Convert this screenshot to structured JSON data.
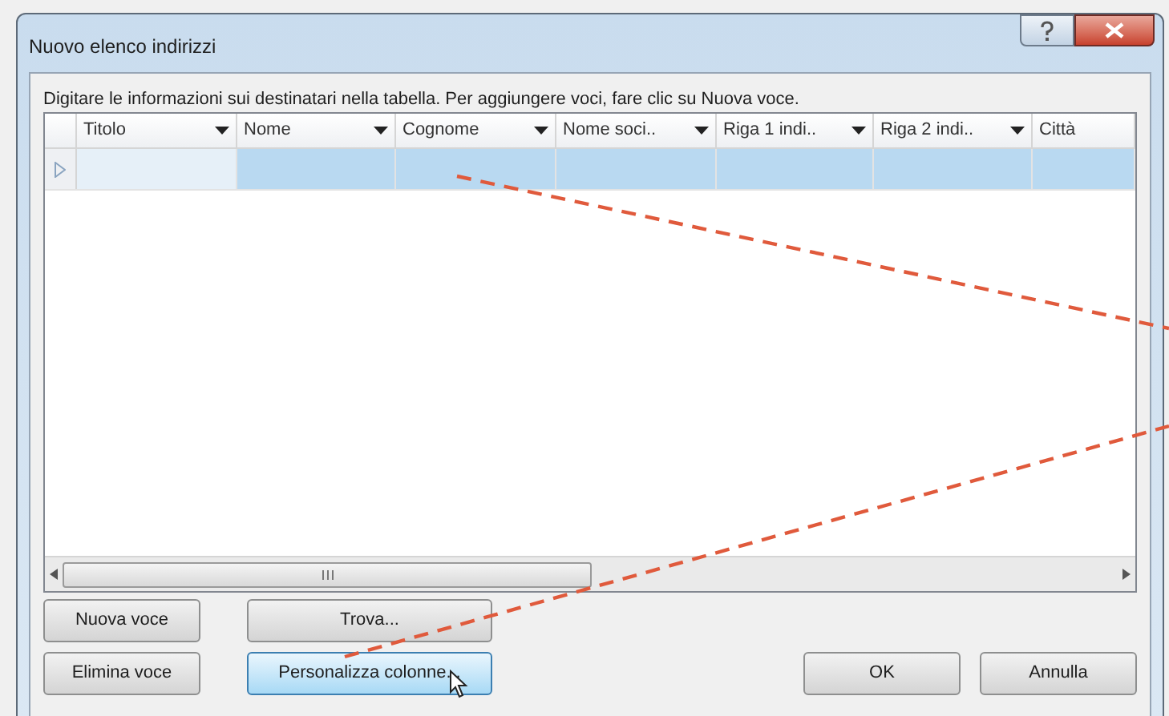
{
  "window": {
    "title": "Nuovo elenco indirizzi"
  },
  "instructions": "Digitare le informazioni sui destinatari nella tabella. Per aggiungere voci, fare clic su Nuova voce.",
  "table": {
    "columns": [
      {
        "label": "Titolo",
        "kind": "filter"
      },
      {
        "label": "Nome",
        "kind": "filter"
      },
      {
        "label": "Cognome",
        "kind": "filter"
      },
      {
        "label": "Nome soci..",
        "kind": "filter"
      },
      {
        "label": "Riga 1 indi..",
        "kind": "filter"
      },
      {
        "label": "Riga 2 indi..",
        "kind": "filter"
      },
      {
        "label": "Città",
        "kind": "plain"
      }
    ],
    "rows": [
      {
        "selected": true
      }
    ]
  },
  "buttons_left": [
    {
      "label": "Nuova voce",
      "hover": false
    },
    {
      "label": "Trova...",
      "hover": false
    },
    {
      "label": "Elimina voce",
      "hover": false
    },
    {
      "label": "Personalizza colonne...",
      "hover": true
    }
  ],
  "buttons_right": [
    {
      "label": "OK"
    },
    {
      "label": "Annulla"
    }
  ]
}
